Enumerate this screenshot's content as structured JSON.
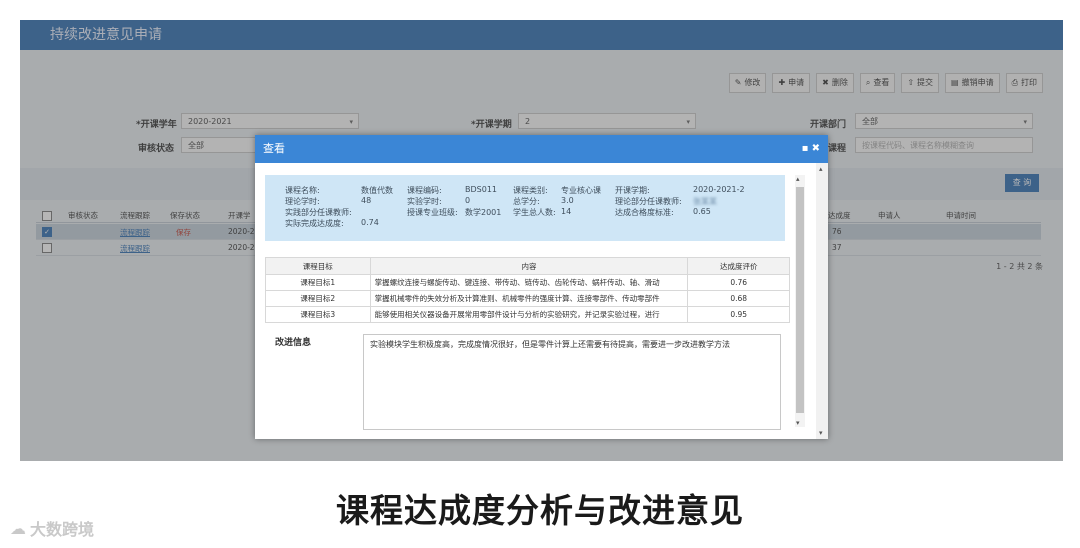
{
  "app": {
    "title": "持续改进意见申请"
  },
  "toolbar": [
    {
      "icon": "edit-icon",
      "glyph": "✎",
      "label": "修改"
    },
    {
      "icon": "add-icon",
      "glyph": "✚",
      "label": "申请"
    },
    {
      "icon": "delete-icon",
      "glyph": "✖",
      "label": "删除"
    },
    {
      "icon": "search-icon",
      "glyph": "⌕",
      "label": "查看"
    },
    {
      "icon": "upload-icon",
      "glyph": "⇧",
      "label": "提交"
    },
    {
      "icon": "revoke-icon",
      "glyph": "▤",
      "label": "撤销申请"
    },
    {
      "icon": "print-icon",
      "glyph": "⎙",
      "label": "打印"
    }
  ],
  "filters": {
    "year_label": "*开课学年",
    "year_value": "2020-2021",
    "term_label": "*开课学期",
    "term_value": "2",
    "dept_label": "开课部门",
    "dept_value": "全部",
    "status_label": "审核状态",
    "status_value": "全部",
    "course_label": "课程",
    "course_placeholder": "按课程代码、课程名称模糊查询",
    "query_label": "查 询"
  },
  "grid": {
    "headers": [
      "审核状态",
      "流程跟踪",
      "保存状态",
      "开课学",
      "达成度",
      "申请人",
      "申请时间"
    ],
    "rows": [
      {
        "selected": true,
        "track": "流程跟踪",
        "save": "保存",
        "year": "2020-20",
        "score": "76"
      },
      {
        "selected": false,
        "track": "流程跟踪",
        "save": "",
        "year": "2020-20",
        "score": "37"
      }
    ],
    "pager": "1 - 2  共 2 条"
  },
  "modal": {
    "title": "查看",
    "ctrl": "▪ ✖",
    "info": {
      "course_name_label": "课程名称:",
      "course_name": "数值代数",
      "course_code_label": "课程编码:",
      "course_code": "BDS011",
      "course_type_label": "课程类别:",
      "course_type": "专业核心课",
      "term_label": "开课学期:",
      "term": "2020-2021-2",
      "theory_hours_label": "理论学时:",
      "theory_hours": "48",
      "lab_hours_label": "实验学时:",
      "lab_hours": "0",
      "credits_label": "总学分:",
      "credits": "3.0",
      "theory_teacher_label": "理论部分任课教师:",
      "theory_teacher": "张某某",
      "practice_teacher_label": "实践部分任课教师:",
      "class_label": "授课专业班级:",
      "class": "数学2001",
      "students_label": "学生总人数:",
      "students": "14",
      "pass_label": "达成合格度标准:",
      "pass": "0.65",
      "actual_label": "实际完成达成度:",
      "actual": "0.74"
    },
    "table": {
      "headers": [
        "课程目标",
        "内容",
        "达成度评价"
      ],
      "rows": [
        {
          "goal": "课程目标1",
          "content": "掌握螺纹连接与螺旋传动、键连接、带传动、链传动、齿轮传动、蜗杆传动、轴、滑动",
          "score": "0.76"
        },
        {
          "goal": "课程目标2",
          "content": "掌握机械零件的失效分析及计算准则、机械零件的强度计算、连接零部件、传动零部件",
          "score": "0.68"
        },
        {
          "goal": "课程目标3",
          "content": "能够使用相关仪器设备开展常用零部件设计与分析的实验研究，并记录实验过程，进行",
          "score": "0.95"
        }
      ]
    },
    "improve_label": "改进信息",
    "improve_text": "实验模块学生积极度高，完成度情况很好，但是零件计算上还需要有待提高，需要进一步改进教学方法"
  },
  "caption": "课程达成度分析与改进意见",
  "watermark": "大数跨境"
}
